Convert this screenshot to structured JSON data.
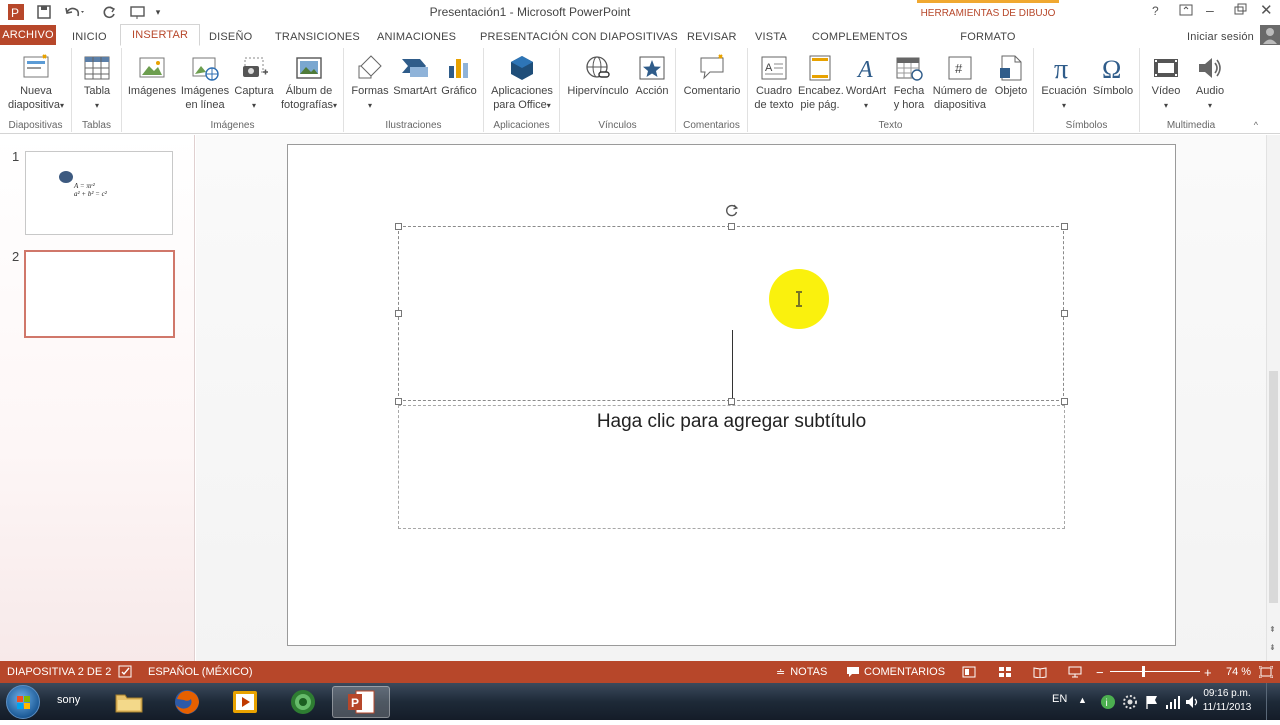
{
  "window": {
    "title": "Presentación1 - Microsoft PowerPoint",
    "context_tab_group": "HERRAMIENTAS DE DIBUJO",
    "help": "?",
    "sign_in": "Iniciar sesión"
  },
  "tabs": [
    "ARCHIVO",
    "INICIO",
    "INSERTAR",
    "DISEÑO",
    "TRANSICIONES",
    "ANIMACIONES",
    "PRESENTACIÓN CON DIAPOSITIVAS",
    "REVISAR",
    "VISTA",
    "COMPLEMENTOS",
    "FORMATO"
  ],
  "ribbon": {
    "groups": [
      "Diapositivas",
      "Tablas",
      "Imágenes",
      "Ilustraciones",
      "Aplicaciones",
      "Vínculos",
      "Comentarios",
      "Texto",
      "Símbolos",
      "Multimedia"
    ],
    "buttons": {
      "nueva": [
        "Nueva",
        "diapositiva"
      ],
      "tabla": [
        "Tabla"
      ],
      "imagenes": [
        "Imágenes"
      ],
      "imagenes_linea": [
        "Imágenes",
        "en línea"
      ],
      "captura": [
        "Captura"
      ],
      "album": [
        "Álbum de",
        "fotografías"
      ],
      "formas": [
        "Formas"
      ],
      "smartart": [
        "SmartArt"
      ],
      "grafico": [
        "Gráfico"
      ],
      "aplicaciones": [
        "Aplicaciones",
        "para Office"
      ],
      "hipervinculo": [
        "Hipervínculo"
      ],
      "accion": [
        "Acción"
      ],
      "comentario": [
        "Comentario"
      ],
      "cuadro": [
        "Cuadro",
        "de texto"
      ],
      "encabez": [
        "Encabez.",
        "pie pág."
      ],
      "wordart": [
        "WordArt"
      ],
      "fecha": [
        "Fecha",
        "y hora"
      ],
      "numero": [
        "Número de",
        "diapositiva"
      ],
      "objeto": [
        "Objeto"
      ],
      "ecuacion": [
        "Ecuación"
      ],
      "simbolo": [
        "Símbolo"
      ],
      "video": [
        "Vídeo"
      ],
      "audio": [
        "Audio"
      ]
    }
  },
  "thumbnails": [
    {
      "number": "1",
      "eq1": "A = πr²",
      "eq2": "a² + b² = c²"
    },
    {
      "number": "2"
    }
  ],
  "slide": {
    "subtitle_placeholder": "Haga clic para agregar subtítulo"
  },
  "status": {
    "slide_info": "DIAPOSITIVA 2 DE 2",
    "language": "ESPAÑOL (MÉXICO)",
    "notes": "NOTAS",
    "comments": "COMENTARIOS",
    "zoom": "74 %",
    "minus": "−",
    "plus": "+",
    "zoom_level": 0.74
  },
  "taskbar": {
    "user": "sony",
    "lang": "EN",
    "time": "09:16 p.m.",
    "date": "11/11/2013"
  },
  "colors": {
    "accent": "#b7472a",
    "context": "#f0a830",
    "taskbar": "#1e2a38"
  }
}
